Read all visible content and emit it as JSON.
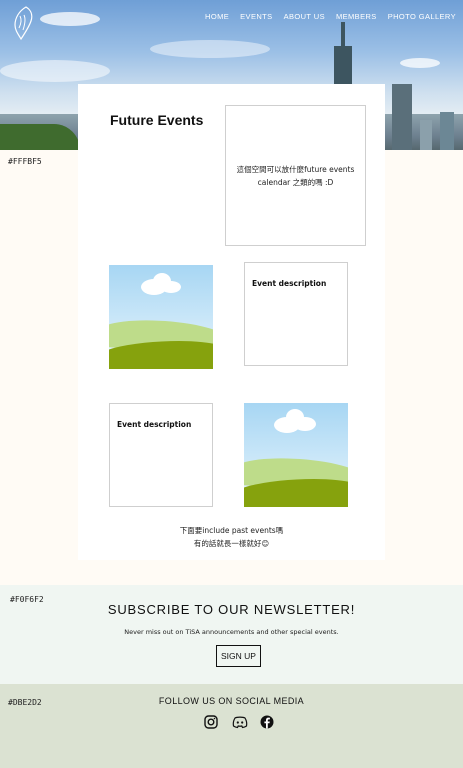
{
  "nav": {
    "items": [
      "HOME",
      "EVENTS",
      "ABOUT US",
      "MEMBERS",
      "PHOTO GALLERY"
    ]
  },
  "logo": {
    "icon": "taiwan-map-icon"
  },
  "swatches": {
    "page_bg": "#FFFBF5",
    "newsletter_bg": "#F0F6F2",
    "social_bg": "#DBE2D2"
  },
  "main": {
    "title": "Future Events",
    "calendar_placeholder": "這個空間可以放什麼future events calendar 之類的嗎 :D",
    "event_description_1": "Event description",
    "event_description_2": "Event description",
    "note_line1": "下面要include past events嗎",
    "note_line2": "有的話就長一樣就好😊"
  },
  "newsletter": {
    "heading": "SUBSCRIBE TO OUR NEWSLETTER!",
    "text": "Never miss out on TiSA announcements and other special events.",
    "button": "SIGN UP"
  },
  "social": {
    "heading": "FOLLOW US ON SOCIAL MEDIA",
    "icons": [
      "instagram-icon",
      "discord-icon",
      "facebook-icon"
    ]
  }
}
